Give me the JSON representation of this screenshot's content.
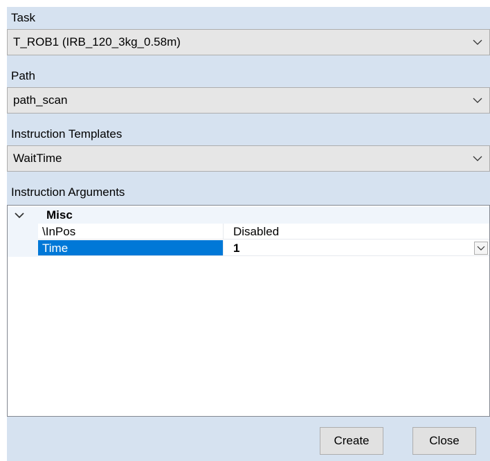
{
  "task": {
    "label": "Task",
    "selected": "T_ROB1 (IRB_120_3kg_0.58m)",
    "arrow_icon": "chevron-down-icon"
  },
  "path": {
    "label": "Path",
    "selected": "path_scan",
    "arrow_icon": "chevron-down-icon"
  },
  "instruction_templates": {
    "label": "Instruction Templates",
    "selected": "WaitTime",
    "arrow_icon": "chevron-down-icon"
  },
  "instruction_arguments": {
    "label": "Instruction Arguments",
    "category": {
      "label": "Misc",
      "expanded": true,
      "icon": "chevron-down-icon"
    },
    "rows": [
      {
        "name": "\\InPos",
        "value": "Disabled",
        "selected": false
      },
      {
        "name": "Time",
        "value": "1",
        "selected": true
      }
    ]
  },
  "buttons": {
    "create": "Create",
    "close": "Close"
  },
  "colors": {
    "panel_background": "#d6e2f0",
    "selection": "#0078d7",
    "combo_background": "#e6e6e6",
    "grid_gutter": "#f0f5fb"
  }
}
